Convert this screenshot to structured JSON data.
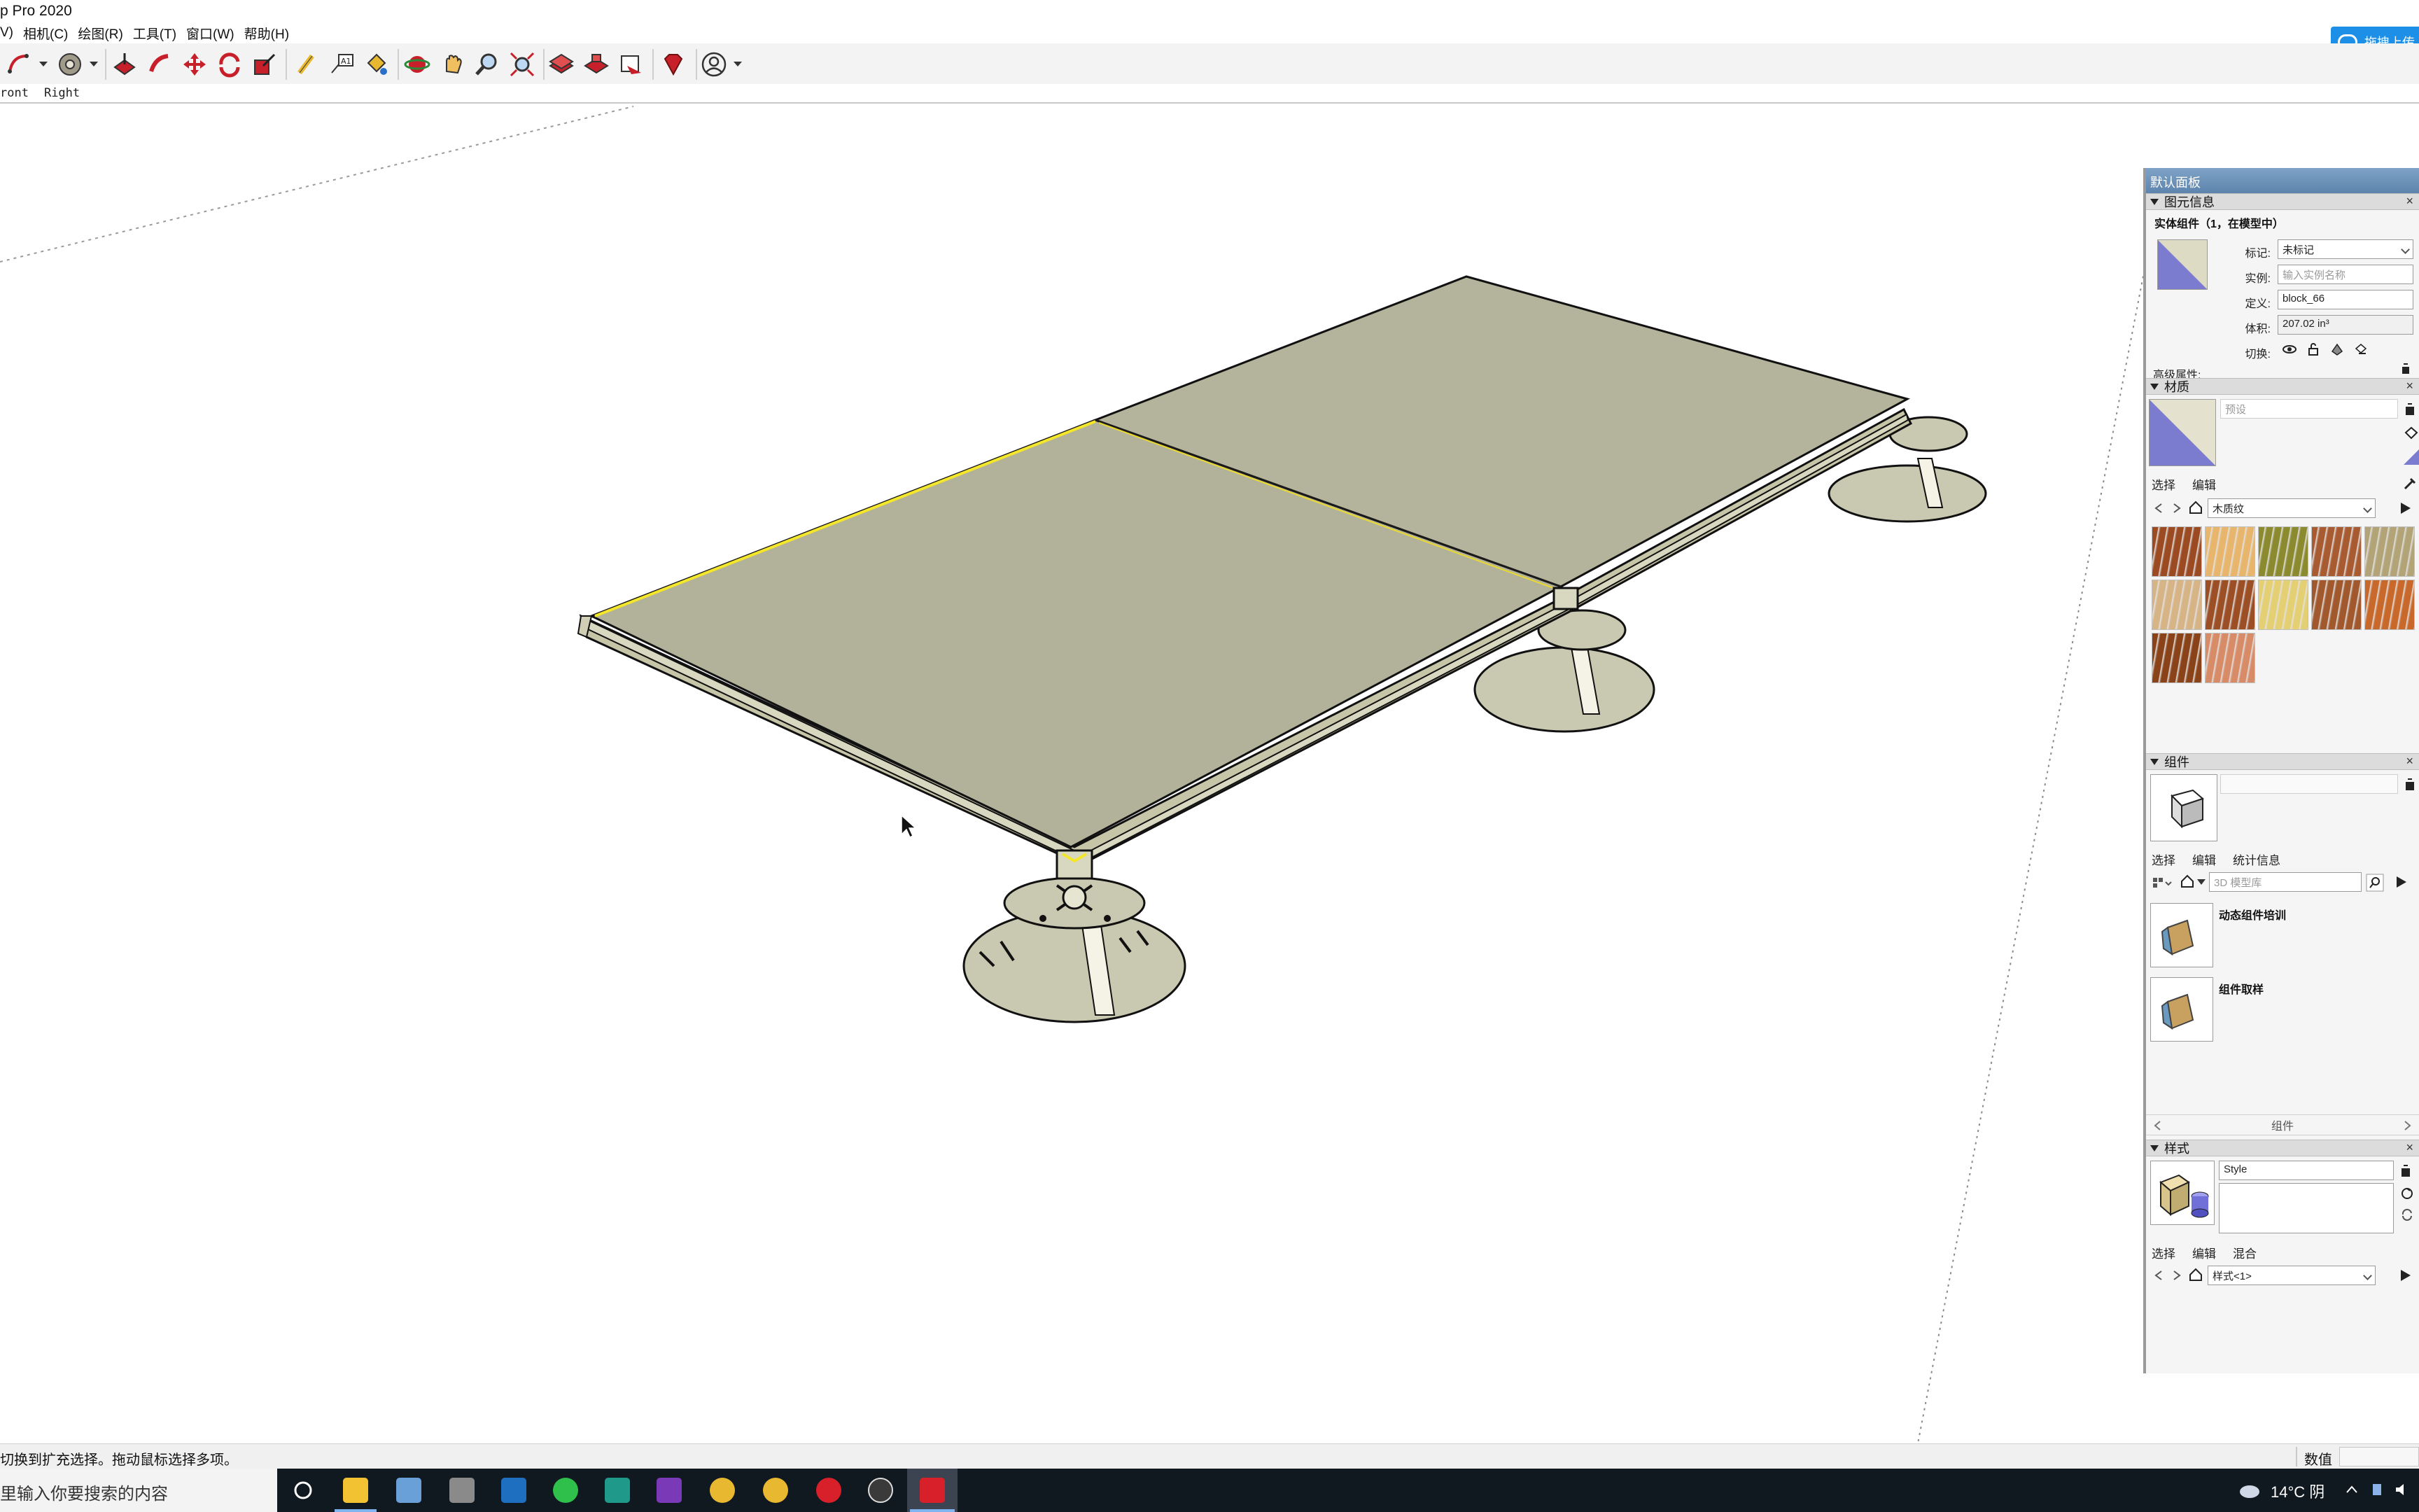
{
  "app": {
    "title": "p Pro 2020",
    "cloud_button_label": "拖拽上传"
  },
  "menu": {
    "items": [
      "V)",
      "相机(C)",
      "绘图(R)",
      "工具(T)",
      "窗口(W)",
      "帮助(H)"
    ]
  },
  "toolbar": {
    "tools": [
      "arc-tool-icon",
      "offset-tool-icon",
      "push-pull-icon",
      "follow-me-icon",
      "move-icon",
      "rotate-icon",
      "scale-icon",
      "tape-measure-icon",
      "text-icon",
      "paint-bucket-icon",
      "orbit-icon",
      "pan-icon",
      "zoom-icon",
      "zoom-extents-icon",
      "3d-warehouse-icon",
      "extension-warehouse-icon",
      "layout-icon",
      "ruby-icon",
      "account-icon"
    ]
  },
  "scenes": {
    "tabs": [
      "ront",
      "Right"
    ]
  },
  "viewport": {
    "cursor": "arrow-cursor"
  },
  "tray": {
    "title": "默认面板",
    "entity_info": {
      "header": "图元信息",
      "subtitle": "实体组件（1，在模型中）",
      "tag_label": "标记:",
      "tag_value": "未标记",
      "instance_label": "实例:",
      "instance_placeholder": "输入实例名称",
      "definition_label": "定义:",
      "definition_value": "block_66",
      "volume_label": "体积:",
      "volume_value": "207.02 in³",
      "toggles_label": "切换:",
      "advanced_label": "高级属性:"
    },
    "materials": {
      "header": "材质",
      "name_placeholder": "预设",
      "tab_select": "选择",
      "tab_edit": "编辑",
      "library_value": "木质纹",
      "swatches": [
        "#9b4a22",
        "#e8b56c",
        "#8c8a2e",
        "#a85a30",
        "#b3a478",
        "#d7b486",
        "#9c4e24",
        "#e4cf72",
        "#a0582c",
        "#c8682a",
        "#8a4318",
        "#d78b66"
      ]
    },
    "components": {
      "header": "组件",
      "tab_select": "选择",
      "tab_edit": "编辑",
      "tab_stats": "统计信息",
      "search_placeholder": "3D 模型库",
      "items": [
        {
          "label": "动态组件培训"
        },
        {
          "label": "组件取样"
        }
      ],
      "footer_label": "组件"
    },
    "styles": {
      "header": "样式",
      "name_value": "Style",
      "tab_select": "选择",
      "tab_edit": "编辑",
      "tab_mix": "混合",
      "style_dropdown_value": "样式<1>"
    }
  },
  "status": {
    "message": "切换到扩充选择。拖动鼠标选择多项。",
    "measurements_label": "数值"
  },
  "taskbar": {
    "search_placeholder": "里输入你要搜索的内容",
    "weather": "14°C 阴"
  }
}
